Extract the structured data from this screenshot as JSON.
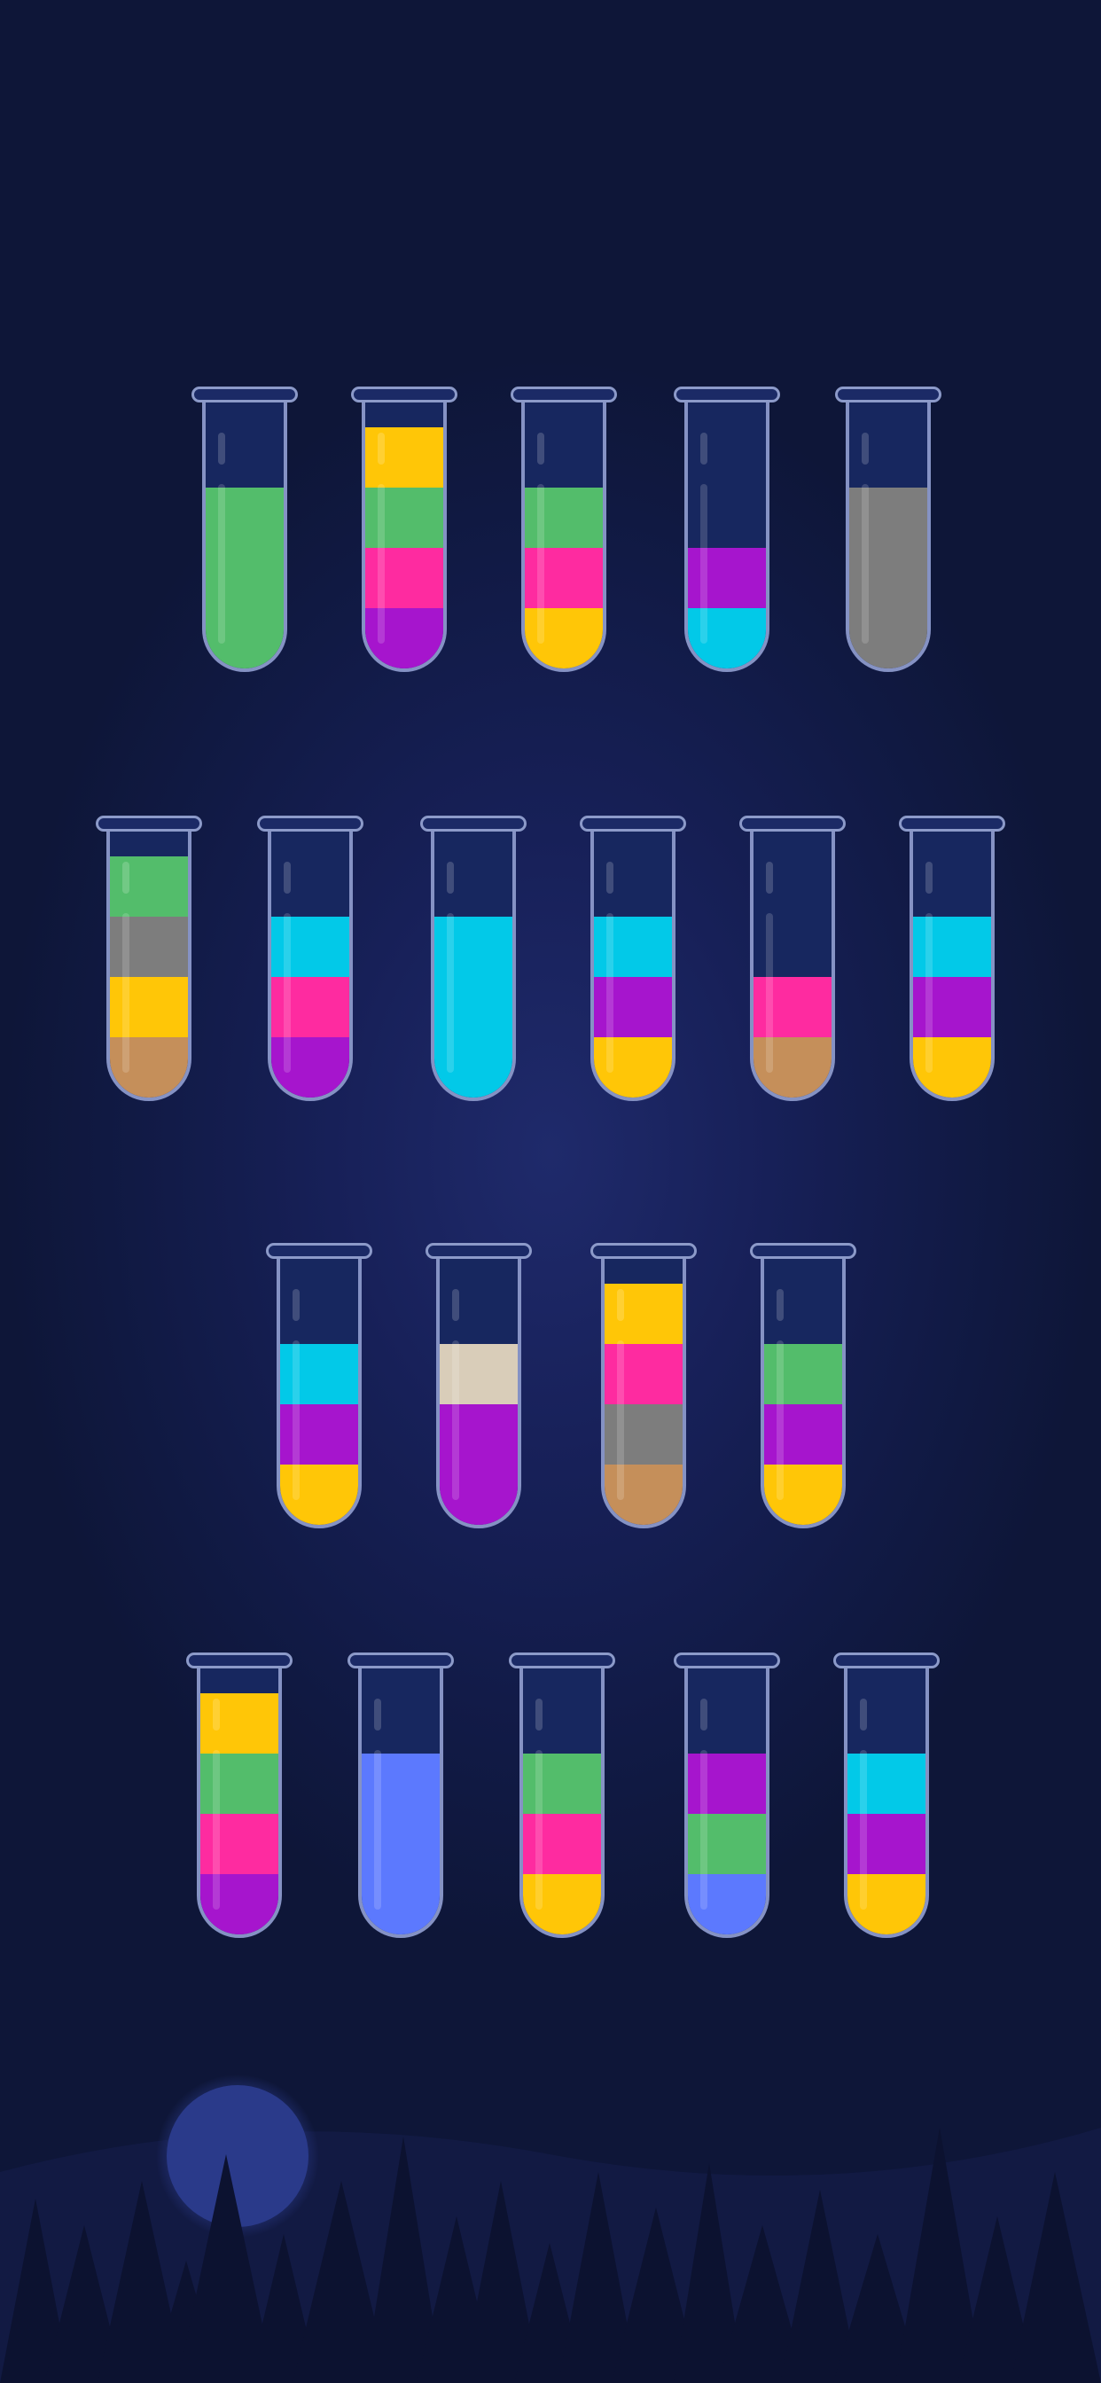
{
  "palette": {
    "green": "#53bd6b",
    "yellow": "#ffc607",
    "pink": "#fe2ba0",
    "purple": "#a615cd",
    "cyan": "#02c9e8",
    "gray": "#7d7d7d",
    "brown": "#c58f5a",
    "cream": "#d9cdb9",
    "blue": "#5c79fe"
  },
  "capacity": 4,
  "rows": [
    {
      "tubes": [
        [
          "green",
          "green",
          "green"
        ],
        [
          "purple",
          "pink",
          "green",
          "yellow"
        ],
        [
          "yellow",
          "pink",
          "green"
        ],
        [
          "cyan",
          "purple"
        ],
        [
          "gray",
          "gray",
          "gray"
        ]
      ]
    },
    {
      "tubes": [
        [
          "brown",
          "yellow",
          "gray",
          "green"
        ],
        [
          "purple",
          "pink",
          "cyan"
        ],
        [
          "cyan",
          "cyan",
          "cyan"
        ],
        [
          "yellow",
          "purple",
          "cyan"
        ],
        [
          "brown",
          "pink"
        ],
        [
          "yellow",
          "purple",
          "cyan"
        ]
      ]
    },
    {
      "tubes": [
        [
          "yellow",
          "purple",
          "cyan"
        ],
        [
          "purple",
          "purple",
          "cream"
        ],
        [
          "brown",
          "gray",
          "pink",
          "yellow"
        ],
        [
          "yellow",
          "purple",
          "green"
        ]
      ]
    },
    {
      "tubes": [
        [
          "purple",
          "pink",
          "green",
          "yellow"
        ],
        [
          "blue",
          "blue",
          "blue"
        ],
        [
          "yellow",
          "pink",
          "green"
        ],
        [
          "blue",
          "green",
          "purple"
        ],
        [
          "yellow",
          "purple",
          "cyan"
        ]
      ]
    }
  ],
  "scenery": {
    "moon_color": "#2a3a8a",
    "tree_color": "#0c1230"
  }
}
